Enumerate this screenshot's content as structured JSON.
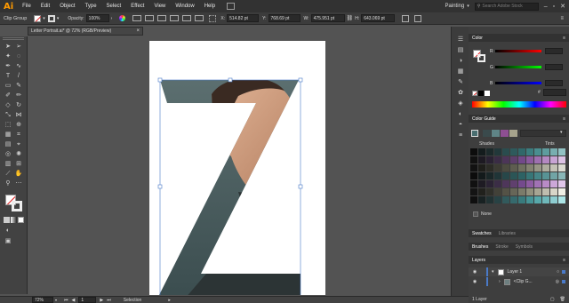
{
  "app": {
    "logo": "Ai"
  },
  "menu": [
    "File",
    "Edit",
    "Object",
    "Type",
    "Select",
    "Effect",
    "View",
    "Window",
    "Help"
  ],
  "workspace": {
    "label": "Painting",
    "search_placeholder": "Search Adobe Stock"
  },
  "control_bar": {
    "selection_type": "Clip Group",
    "opacity_label": "Opacity:",
    "opacity_value": "100%",
    "x_label": "X:",
    "x_value": "514.82 pt",
    "y_label": "Y:",
    "y_value": "768.69 pt",
    "w_label": "W:",
    "w_value": "475.951 pt",
    "h_label": "H:",
    "h_value": "643.069 pt"
  },
  "document_tab": {
    "title": "Letter Portrait.ai* @ 72% (RGB/Preview)"
  },
  "artwork": {
    "letter": "Z"
  },
  "status_bar": {
    "zoom": "72%",
    "page": "1",
    "tool": "Selection"
  },
  "panels": {
    "color": {
      "tab": "Color",
      "channels": [
        {
          "label": "R"
        },
        {
          "label": "G"
        },
        {
          "label": "B"
        }
      ],
      "hex_prefix": "#"
    },
    "color_guide": {
      "tab": "Color Guide",
      "shades_label": "Shades",
      "tints_label": "Tints",
      "none_label": "None",
      "base_swatches": [
        "#3a4a4c",
        "#5f8486",
        "#8e4f93",
        "#a6a38c"
      ],
      "grid_rows": [
        [
          "#0d0d0d",
          "#141c1d",
          "#1c2a2b",
          "#22383a",
          "#2a4c4e",
          "#2e5a5c",
          "#30686a",
          "#3b7d7f",
          "#4a8e90",
          "#5e9c9e",
          "#78aeb0",
          "#92c2c3"
        ],
        [
          "#111111",
          "#1d1a22",
          "#2a2233",
          "#3a2c45",
          "#4c3558",
          "#5e3f6c",
          "#72498a",
          "#8a5a9e",
          "#9e70b0",
          "#b488c2",
          "#c8a4d4",
          "#dcc2e4"
        ],
        [
          "#121212",
          "#1e1e1a",
          "#2c2c26",
          "#3c3b33",
          "#4c4b40",
          "#5e5d50",
          "#707060",
          "#848372",
          "#989686",
          "#aeac9e",
          "#c4c2b6",
          "#dad9d0"
        ]
      ]
    },
    "swatches_tabs": [
      "Swatches",
      "Libraries"
    ],
    "brushes_tabs": [
      "Brushes",
      "Stroke",
      "Symbols"
    ],
    "layers": {
      "tab": "Layers",
      "rows": [
        {
          "name": "Layer 1"
        },
        {
          "name": "<Clip G..."
        }
      ],
      "footer": "1 Layer"
    }
  }
}
